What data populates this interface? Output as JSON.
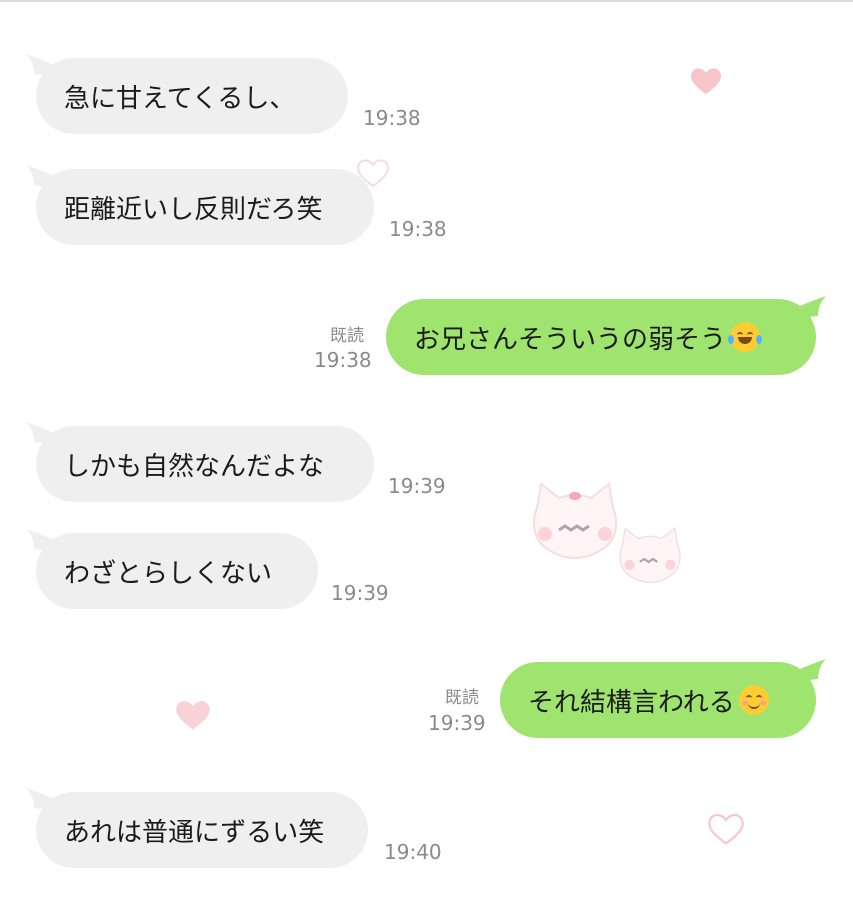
{
  "messages": [
    {
      "text": "急に甘えてくるし、",
      "time": "19:38"
    },
    {
      "text": "距離近いし反則だろ笑",
      "time": "19:38"
    },
    {
      "text": "お兄さんそういうの弱そう",
      "emoji": "face-with-tears-of-joy",
      "time": "19:38",
      "read": "既読"
    },
    {
      "text": "しかも自然なんだよな",
      "time": "19:39"
    },
    {
      "text": "わざとらしくない",
      "time": "19:39"
    },
    {
      "text": "それ結構言われる",
      "emoji": "smiling-face",
      "time": "19:39",
      "read": "既読"
    },
    {
      "text": "あれは普通にずるい笑",
      "time": "19:40"
    }
  ],
  "colors": {
    "incoming_bubble": "#efefef",
    "outgoing_bubble": "#9ee46e",
    "meta_text": "#8a8a8a",
    "heart": "#f7c5c9"
  },
  "decorations": [
    "heart-icon",
    "heart-icon",
    "heart-icon",
    "heart-icon",
    "cat-sticker-icon",
    "cat-sticker-icon"
  ]
}
